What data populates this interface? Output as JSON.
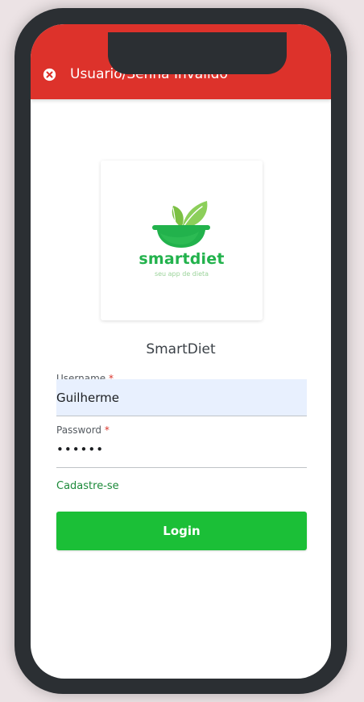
{
  "notification": {
    "message": "Usuario/Senha Invalido",
    "icon": "close-circle-icon",
    "color": "#dd322b"
  },
  "logo": {
    "name": "smartdiet",
    "tagline": "seu app de dieta",
    "color": "#22b24c"
  },
  "app": {
    "title": "SmartDiet"
  },
  "form": {
    "username": {
      "label": "Username",
      "required_marker": "*",
      "value": "Guilherme"
    },
    "password": {
      "label": "Password",
      "required_marker": "*",
      "value": "••••••"
    },
    "register_link": "Cadastre-se",
    "login_label": "Login",
    "accent": "#1bbf37"
  }
}
